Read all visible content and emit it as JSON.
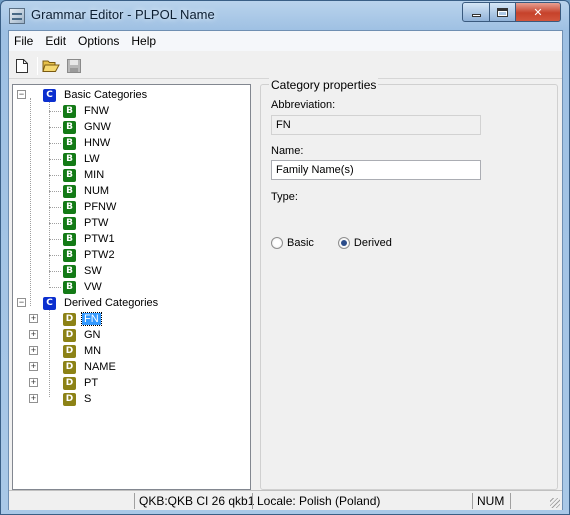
{
  "window": {
    "title": "Grammar Editor - PLPOL Name"
  },
  "menu": [
    "File",
    "Edit",
    "Options",
    "Help"
  ],
  "toolbar": {
    "icons": [
      "new-document-icon",
      "open-folder-icon",
      "save-icon"
    ]
  },
  "tree": {
    "basic": {
      "icon": "C",
      "label": "Basic Categories",
      "items": [
        {
          "icon": "B",
          "label": "FNW"
        },
        {
          "icon": "B",
          "label": "GNW"
        },
        {
          "icon": "B",
          "label": "HNW"
        },
        {
          "icon": "B",
          "label": "LW"
        },
        {
          "icon": "B",
          "label": "MIN"
        },
        {
          "icon": "B",
          "label": "NUM"
        },
        {
          "icon": "B",
          "label": "PFNW"
        },
        {
          "icon": "B",
          "label": "PTW"
        },
        {
          "icon": "B",
          "label": "PTW1"
        },
        {
          "icon": "B",
          "label": "PTW2"
        },
        {
          "icon": "B",
          "label": "SW"
        },
        {
          "icon": "B",
          "label": "VW"
        }
      ]
    },
    "derived": {
      "icon": "C",
      "label": "Derived Categories",
      "items": [
        {
          "icon": "D",
          "label": "FN",
          "selected": true
        },
        {
          "icon": "D",
          "label": "GN"
        },
        {
          "icon": "D",
          "label": "MN"
        },
        {
          "icon": "D",
          "label": "NAME"
        },
        {
          "icon": "D",
          "label": "PT"
        },
        {
          "icon": "D",
          "label": "S"
        }
      ]
    }
  },
  "props": {
    "group_title": "Category properties",
    "abbreviation_label": "Abbreviation:",
    "abbreviation_value": "FN",
    "name_label": "Name:",
    "name_value": "Family Name(s)",
    "type_label": "Type:",
    "type_basic": "Basic",
    "type_derived": "Derived",
    "type_selected": "Derived"
  },
  "status": {
    "kb": "QKB:QKB CI 26 qkb1",
    "locale": "Locale: Polish (Poland)",
    "num": "NUM"
  },
  "colors": {
    "category_icon": "#0b2fcf",
    "basic_icon": "#137a16",
    "derived_icon": "#8c8216",
    "selection": "#3399ff"
  }
}
